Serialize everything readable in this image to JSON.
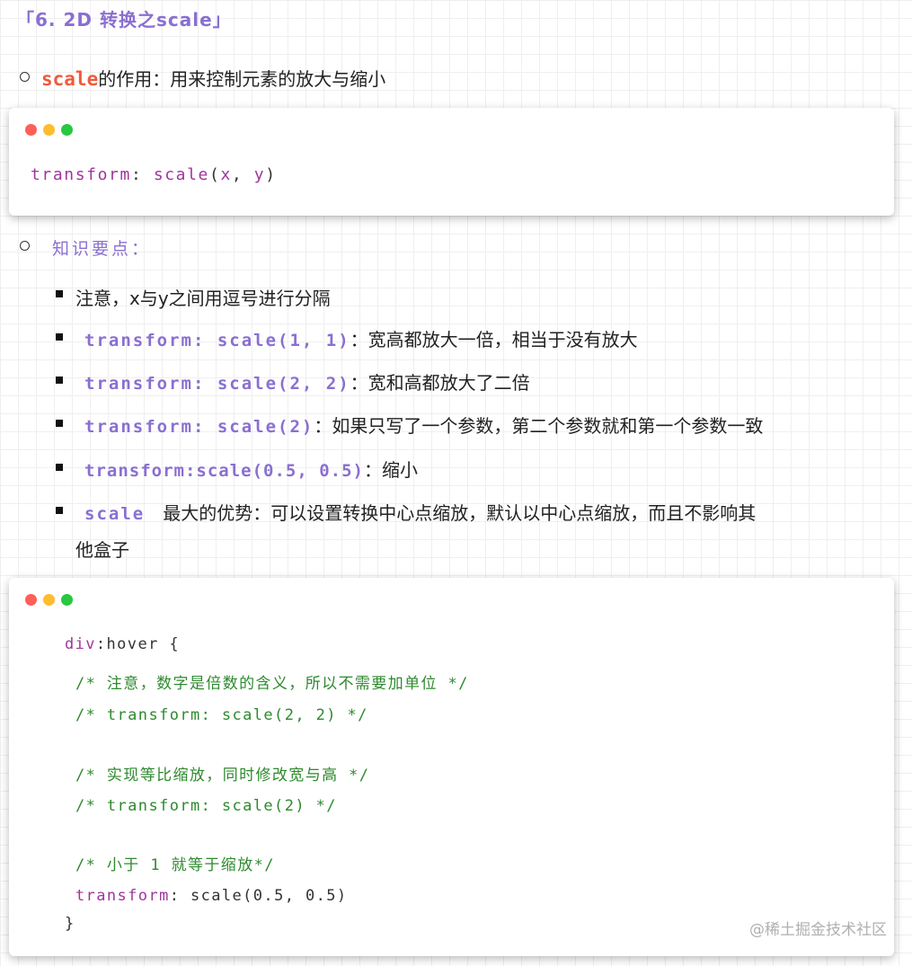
{
  "heading": "「6. 2D 转换之scale」",
  "bullet1": {
    "keyword": "scale",
    "text": "的作用：用来控制元素的放大与缩小"
  },
  "code_block_1": {
    "property": "transform",
    "colon": ":",
    "func": "scale",
    "open": "(",
    "x": "x",
    "comma": ",",
    "y": "y",
    "close": ")"
  },
  "subheading": "知识要点：",
  "points": [
    {
      "code": "",
      "text": "注意，x与y之间用逗号进行分隔"
    },
    {
      "code": "transform: scale(1, 1)",
      "text": "：宽高都放大一倍，相当于没有放大"
    },
    {
      "code": "transform: scale(2, 2)",
      "text": "：宽和高都放大了二倍"
    },
    {
      "code": "transform: scale(2)",
      "text": "：如果只写了一个参数，第二个参数就和第一个参数一致"
    },
    {
      "code": "transform:scale(0.5, 0.5)",
      "text": "：缩小"
    },
    {
      "code": "scale",
      "text": "最大的优势：可以设置转换中心点缩放，默认以中心点缩放，而且不影响其",
      "text2": "他盒子"
    }
  ],
  "code_block_2": {
    "selector": "div",
    "pseudo": ":hover {",
    "comment1": "/* 注意，数字是倍数的含义，所以不需要加单位 */",
    "comment2": "/* transform: scale(2, 2) */",
    "comment3": "/* 实现等比缩放，同时修改宽与高 */",
    "comment4": "/* transform: scale(2) */",
    "comment5": "/* 小于 1 就等于缩放*/",
    "property": "transform",
    "value": ": scale(0.5, 0.5)",
    "close_brace": "}"
  },
  "watermark": "@稀土掘金技术社区"
}
